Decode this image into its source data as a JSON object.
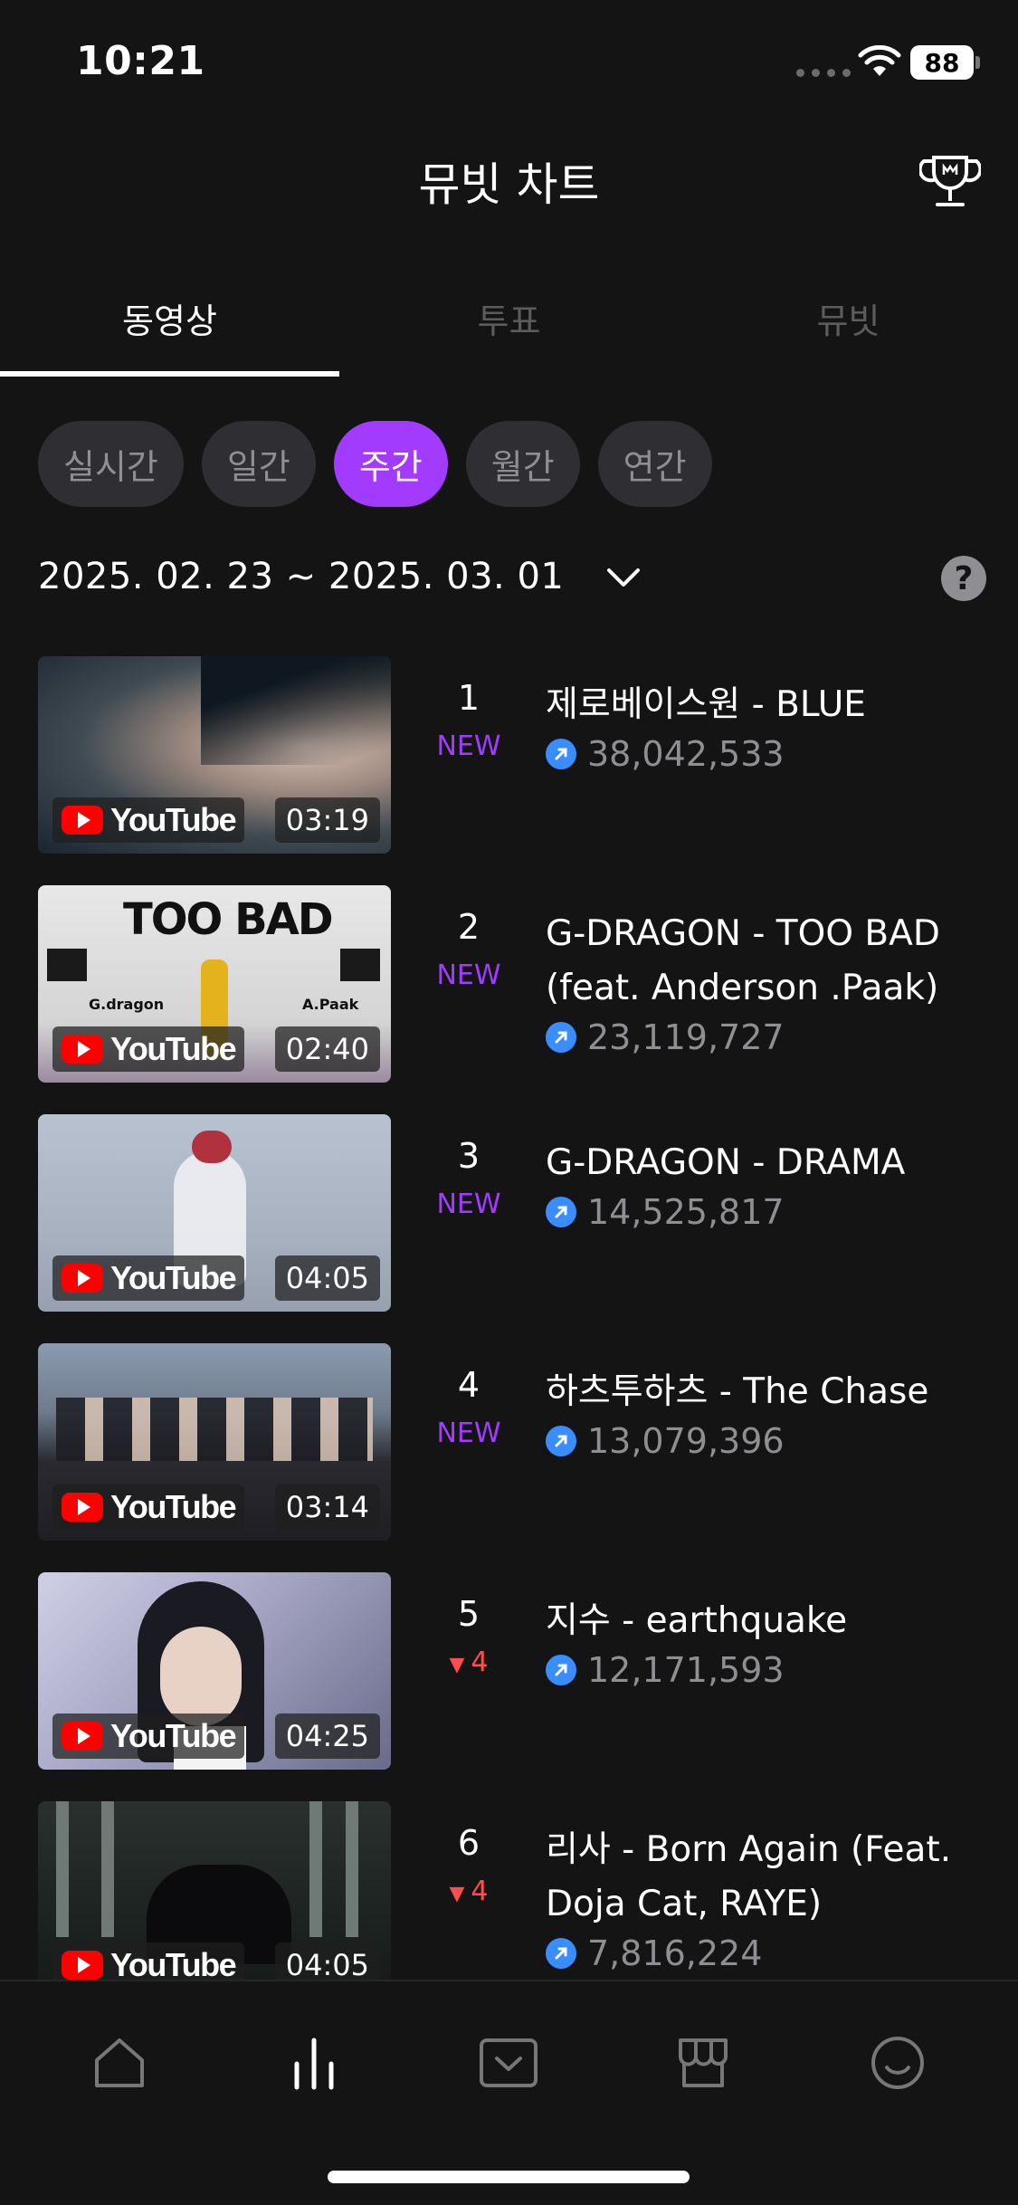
{
  "status_bar": {
    "time": "10:21",
    "battery": "88"
  },
  "header": {
    "title": "뮤빗 차트"
  },
  "tabs": [
    {
      "label": "동영상",
      "active": true
    },
    {
      "label": "투표",
      "active": false
    },
    {
      "label": "뮤빗",
      "active": false
    }
  ],
  "periods": [
    {
      "label": "실시간",
      "active": false
    },
    {
      "label": "일간",
      "active": false
    },
    {
      "label": "주간",
      "active": true
    },
    {
      "label": "월간",
      "active": false
    },
    {
      "label": "연간",
      "active": false
    }
  ],
  "date_range": "2025. 02. 23 ~ 2025. 03. 01",
  "help_label": "?",
  "youtube_label": "YouTube",
  "chart": [
    {
      "rank": "1",
      "change": "NEW",
      "change_type": "new",
      "title": "제로베이스원 - BLUE",
      "views": "38,042,533",
      "duration": "03:19"
    },
    {
      "rank": "2",
      "change": "NEW",
      "change_type": "new",
      "title": "G-DRAGON - TOO BAD (feat. Anderson .Paak)",
      "views": "23,119,727",
      "duration": "02:40",
      "thumb_overlay": {
        "headline": "TOO BAD",
        "left_name": "G.dragon",
        "right_name": "A.Paak"
      }
    },
    {
      "rank": "3",
      "change": "NEW",
      "change_type": "new",
      "title": "G-DRAGON - DRAMA",
      "views": "14,525,817",
      "duration": "04:05"
    },
    {
      "rank": "4",
      "change": "NEW",
      "change_type": "new",
      "title": "하츠투하츠 - The Chase",
      "views": "13,079,396",
      "duration": "03:14"
    },
    {
      "rank": "5",
      "change": "4",
      "change_type": "down",
      "title": "지수 - earthquake",
      "views": "12,171,593",
      "duration": "04:25"
    },
    {
      "rank": "6",
      "change": "4",
      "change_type": "down",
      "title": "리사 - Born Again (Feat. Doja Cat, RAYE)",
      "views": "7,816,224",
      "duration": "04:05"
    }
  ],
  "bottom_nav": [
    {
      "icon": "home-icon",
      "active": false
    },
    {
      "icon": "chart-icon",
      "active": true
    },
    {
      "icon": "vote-icon",
      "active": false
    },
    {
      "icon": "store-icon",
      "active": false
    },
    {
      "icon": "profile-icon",
      "active": false
    }
  ],
  "colors": {
    "accent": "#a33bff",
    "down": "#ff4d4d",
    "views_icon": "#3a8dff",
    "background": "#141414"
  }
}
